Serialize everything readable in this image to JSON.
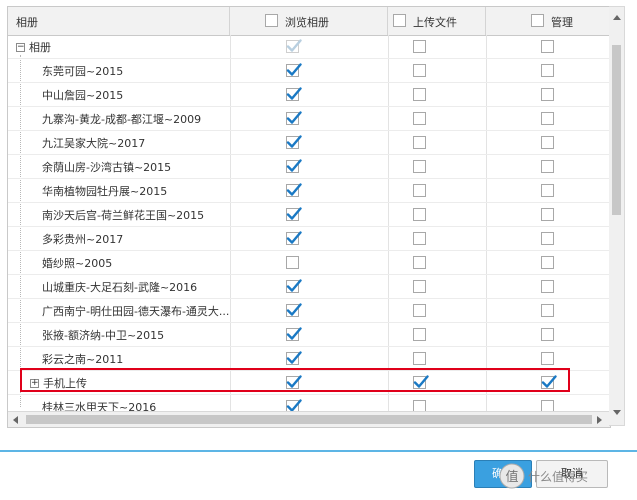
{
  "header": {
    "col_album": "相册",
    "col_browse": "浏览相册",
    "col_upload": "上传文件",
    "col_manage": "管理",
    "browse_checked": false,
    "upload_checked": false,
    "manage_checked": false
  },
  "root": {
    "label": "相册",
    "browse": true,
    "upload": false,
    "manage": false
  },
  "rows": [
    {
      "label": "东莞可园~2015",
      "browse": true,
      "upload": false,
      "manage": false
    },
    {
      "label": "中山詹园~2015",
      "browse": true,
      "upload": false,
      "manage": false
    },
    {
      "label": "九寨沟-黄龙-成都-都江堰~2009",
      "browse": true,
      "upload": false,
      "manage": false
    },
    {
      "label": "九江吴家大院~2017",
      "browse": true,
      "upload": false,
      "manage": false
    },
    {
      "label": "余荫山房-沙湾古镇~2015",
      "browse": true,
      "upload": false,
      "manage": false
    },
    {
      "label": "华南植物园牡丹展~2015",
      "browse": true,
      "upload": false,
      "manage": false
    },
    {
      "label": "南沙天后宫-荷兰鲜花王国~2015",
      "browse": true,
      "upload": false,
      "manage": false
    },
    {
      "label": "多彩贵州~2017",
      "browse": true,
      "upload": false,
      "manage": false
    },
    {
      "label": "婚纱照~2005",
      "browse": false,
      "upload": false,
      "manage": false
    },
    {
      "label": "山城重庆-大足石刻-武隆~2016",
      "browse": true,
      "upload": false,
      "manage": false
    },
    {
      "label": "广西南宁-明仕田园-德天瀑布-通灵大...",
      "browse": true,
      "upload": false,
      "manage": false
    },
    {
      "label": "张掖-额济纳-中卫~2015",
      "browse": true,
      "upload": false,
      "manage": false
    },
    {
      "label": "彩云之南~2011",
      "browse": true,
      "upload": false,
      "manage": false
    },
    {
      "label": "手机上传",
      "browse": true,
      "upload": true,
      "manage": true,
      "expandable": true
    },
    {
      "label": "桂林三水甲天下~2016",
      "browse": true,
      "upload": false,
      "manage": false
    }
  ],
  "footer": {
    "ok_label": "确定",
    "cancel_label": "取消"
  },
  "watermark": "值 什么值得买",
  "colors": {
    "accent": "#3aa0e0",
    "highlight": "#e0001a",
    "check": "#1a79c4"
  }
}
